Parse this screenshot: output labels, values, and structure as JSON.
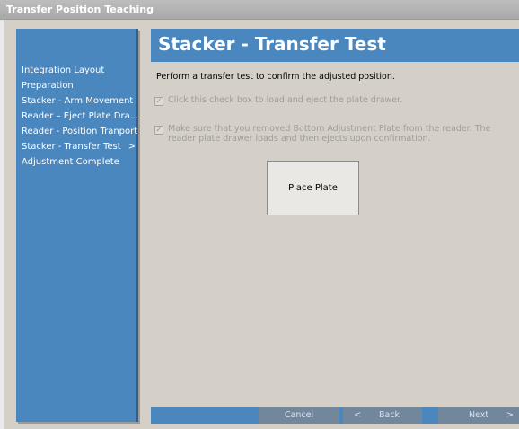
{
  "window": {
    "title": "Transfer Position Teaching"
  },
  "sidebar": {
    "items": [
      {
        "label": "Integration Layout"
      },
      {
        "label": "Preparation"
      },
      {
        "label": "Stacker - Arm Movement"
      },
      {
        "label": "Reader – Eject Plate Dra..."
      },
      {
        "label": "Reader - Position Tranport"
      },
      {
        "label": "Stacker - Transfer Test"
      },
      {
        "label": "Adjustment Complete"
      }
    ],
    "current_arrow": ">"
  },
  "main": {
    "title": "Stacker - Transfer Test",
    "instruction": "Perform a transfer test to confirm the adjusted position.",
    "checks": [
      {
        "label": "Click this check box to load and eject the plate drawer.",
        "checked": true
      },
      {
        "label": "Make sure that you removed Bottom Adjustment Plate from the reader. The reader plate drawer loads and then ejects upon confirmation.",
        "checked": true
      }
    ],
    "place_plate_button": "Place Plate"
  },
  "footer": {
    "cancel": "Cancel",
    "back": "Back",
    "back_chevron": "<",
    "next": "Next",
    "next_chevron": ">"
  },
  "colors": {
    "accent_blue": "#4a87bf",
    "disabled_button": "#73879c",
    "panel": "#d4d0c8"
  }
}
